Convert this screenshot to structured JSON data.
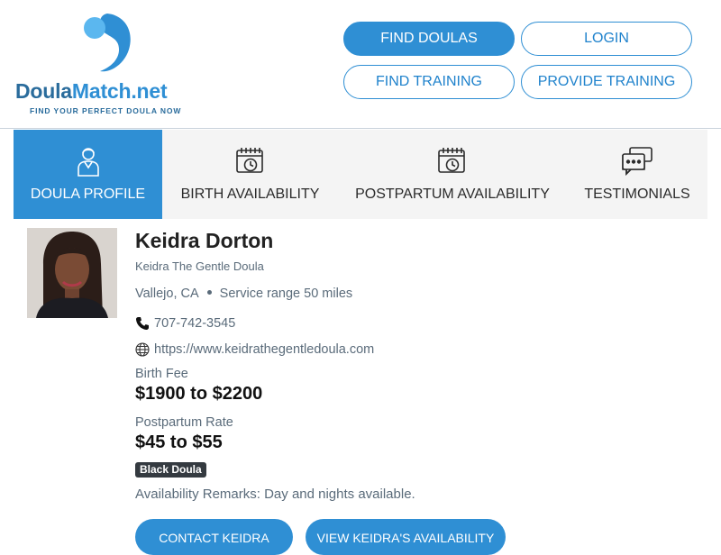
{
  "brand": {
    "word_a": "Doula",
    "word_b": "Match.net",
    "tagline": "FIND YOUR PERFECT DOULA NOW",
    "colors": {
      "primary": "#2f8fd4",
      "dark": "#2a6c9c",
      "light": "#5bb7ef"
    }
  },
  "nav": {
    "find_doulas": "FIND DOULAS",
    "login": "LOGIN",
    "find_training": "FIND TRAINING",
    "provide_training": "PROVIDE TRAINING"
  },
  "tabs": [
    {
      "label": "DOULA PROFILE",
      "icon": "doula-person-icon",
      "active": true
    },
    {
      "label": "BIRTH AVAILABILITY",
      "icon": "calendar-clock-icon",
      "active": false
    },
    {
      "label": "POSTPARTUM AVAILABILITY",
      "icon": "calendar-clock-icon",
      "active": false
    },
    {
      "label": "TESTIMONIALS",
      "icon": "chat-bubbles-icon",
      "active": false
    }
  ],
  "profile": {
    "name": "Keidra Dorton",
    "business": "Keidra The Gentle Doula",
    "city": "Vallejo, CA",
    "service_range": "Service range 50 miles",
    "phone": "707-742-3545",
    "website": "https://www.keidrathegentledoula.com",
    "birth_fee_label": "Birth Fee",
    "birth_fee": "$1900 to $2200",
    "postpartum_label": "Postpartum Rate",
    "postpartum_rate": "$45 to $55",
    "badge": "Black Doula",
    "remarks": "Availability Remarks: Day and nights available."
  },
  "actions": {
    "contact": "CONTACT KEIDRA",
    "availability": "VIEW KEIDRA'S AVAILABILITY"
  }
}
